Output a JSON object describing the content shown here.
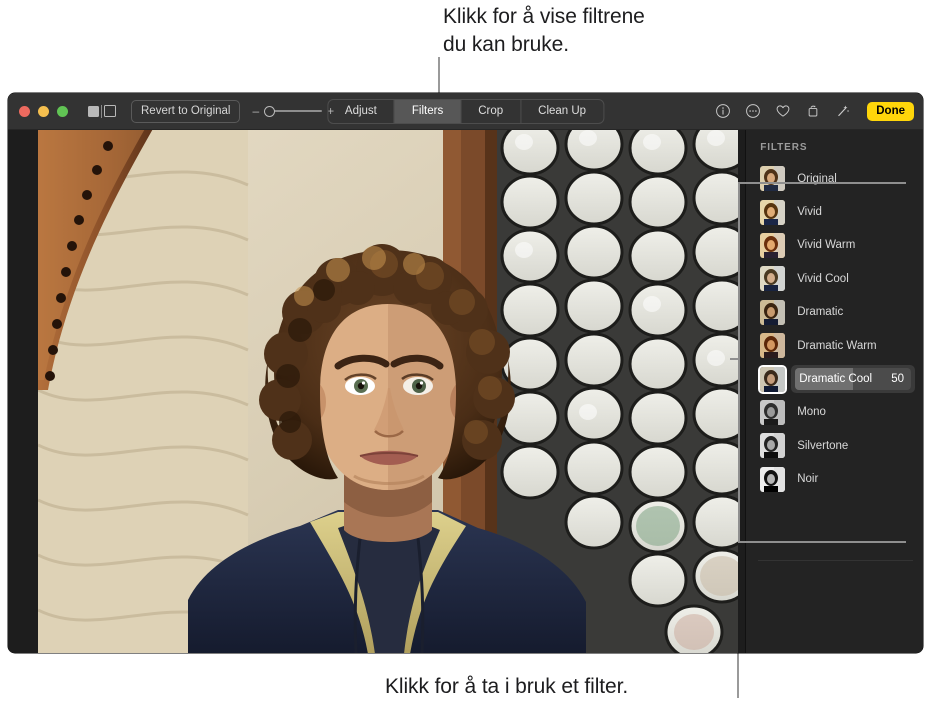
{
  "callouts": {
    "top": "Klikk for å vise filtrene\ndu kan bruke.",
    "bottom": "Klikk for å ta i bruk et filter."
  },
  "toolbar": {
    "revert_label": "Revert to Original",
    "zoom_minus": "–",
    "zoom_plus": "+",
    "segments": [
      {
        "label": "Adjust",
        "selected": false
      },
      {
        "label": "Filters",
        "selected": true
      },
      {
        "label": "Crop",
        "selected": false
      },
      {
        "label": "Clean Up",
        "selected": false
      }
    ],
    "icons": [
      "info-icon",
      "more-options-icon",
      "favorite-heart-icon",
      "rotate-icon",
      "auto-enhance-wand-icon"
    ],
    "done_label": "Done",
    "done_color": "#ffd60a",
    "window_controls": [
      "close",
      "minimize",
      "zoom"
    ],
    "view_toggle": "split-view-icon"
  },
  "filters_panel": {
    "title": "FILTERS",
    "items": [
      {
        "label": "Original",
        "selected": false,
        "value": null,
        "tone": "original"
      },
      {
        "label": "Vivid",
        "selected": false,
        "value": null,
        "tone": "vivid"
      },
      {
        "label": "Vivid Warm",
        "selected": false,
        "value": null,
        "tone": "vivid-warm"
      },
      {
        "label": "Vivid Cool",
        "selected": false,
        "value": null,
        "tone": "vivid-cool"
      },
      {
        "label": "Dramatic",
        "selected": false,
        "value": null,
        "tone": "dramatic"
      },
      {
        "label": "Dramatic Warm",
        "selected": false,
        "value": null,
        "tone": "dramatic-warm"
      },
      {
        "label": "Dramatic Cool",
        "selected": true,
        "value": "50",
        "tone": "dramatic-cool"
      },
      {
        "label": "Mono",
        "selected": false,
        "value": null,
        "tone": "mono"
      },
      {
        "label": "Silvertone",
        "selected": false,
        "value": null,
        "tone": "silvertone"
      },
      {
        "label": "Noir",
        "selected": false,
        "value": null,
        "tone": "noir"
      }
    ],
    "selected_value": "50",
    "selected_percent": 50
  },
  "colors": {
    "toolbar_bg": "#333333",
    "window_bg": "#1d1d1d",
    "panel_bg": "#232323",
    "accent_done": "#ffd60a",
    "selection_bg": "#3a3a3a",
    "callout_leader": "#9a9a9a"
  }
}
